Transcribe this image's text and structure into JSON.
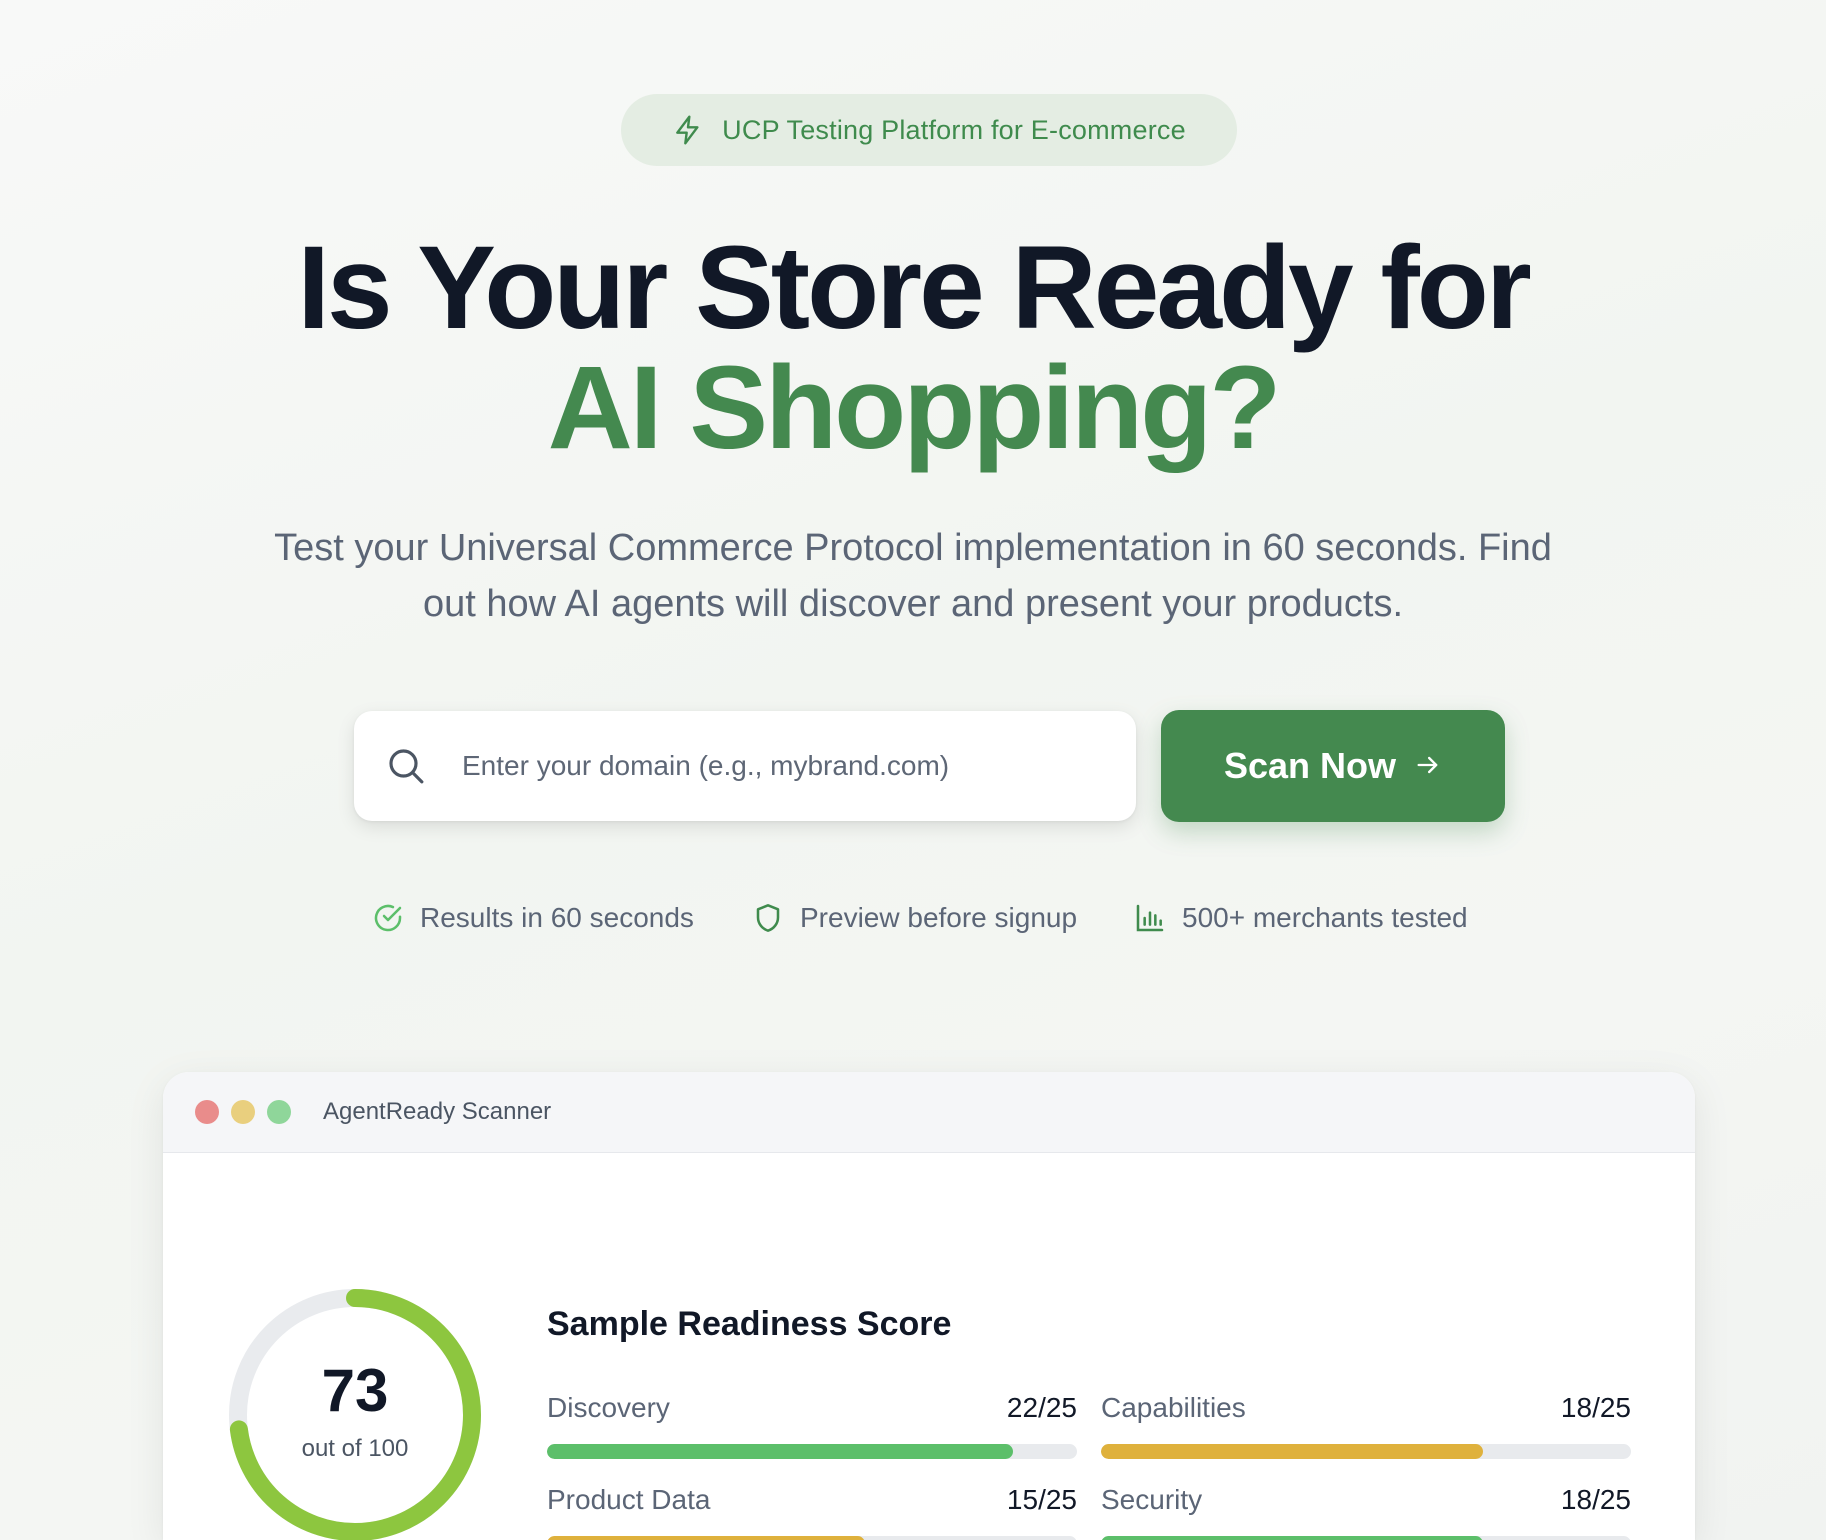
{
  "badge": {
    "icon": "lightning-icon",
    "text": "UCP Testing Platform for E-commerce"
  },
  "hero": {
    "headline_line1": "Is Your Store Ready for",
    "headline_line2": "AI Shopping?",
    "subtitle": "Test your Universal Commerce Protocol implementation in 60 seconds. Find out how AI agents will discover and present your products."
  },
  "search": {
    "value": "",
    "placeholder": "Enter your domain (e.g., mybrand.com)",
    "button_label": "Scan Now"
  },
  "features": [
    {
      "icon": "check-circle-icon",
      "label": "Results in 60 seconds"
    },
    {
      "icon": "shield-icon",
      "label": "Preview before signup"
    },
    {
      "icon": "bar-chart-icon",
      "label": "500+ merchants tested"
    }
  ],
  "scanner": {
    "window_title": "AgentReady Scanner",
    "score": {
      "value": 73,
      "value_text": "73",
      "caption": "out of 100",
      "max": 100
    },
    "section_title": "Sample Readiness Score",
    "metrics": [
      {
        "label": "Discovery",
        "value_text": "22/25",
        "score": 22,
        "max": 25,
        "color": "#5cbf6a"
      },
      {
        "label": "Capabilities",
        "value_text": "18/25",
        "score": 18,
        "max": 25,
        "color": "#dfb13c"
      },
      {
        "label": "Product Data",
        "value_text": "15/25",
        "score": 15,
        "max": 25,
        "color": "#dfb13c"
      },
      {
        "label": "Security",
        "value_text": "18/25",
        "score": 18,
        "max": 25,
        "color": "#5cbf6a"
      }
    ]
  },
  "colors": {
    "accent": "#44894f",
    "badge_bg": "#e4ede3",
    "gauge": "#8dc63f",
    "gauge_track": "#e9ebee",
    "window_red": "#e98c8b",
    "window_yellow": "#e9cf7e",
    "window_green": "#8fd69a"
  }
}
